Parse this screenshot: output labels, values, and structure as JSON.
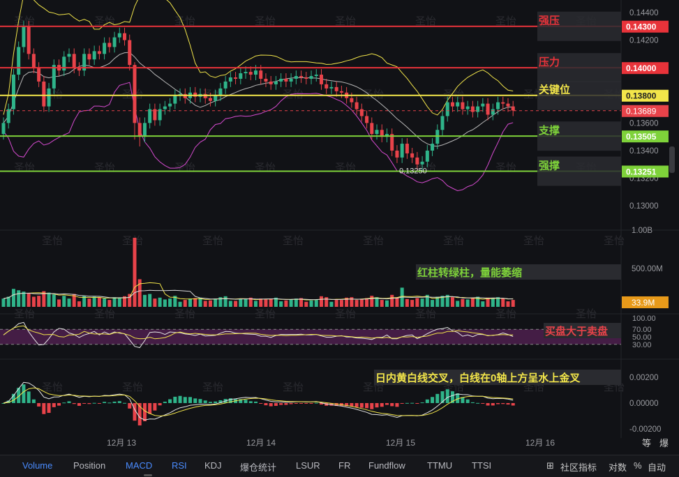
{
  "chart_data": {
    "type": "candlestick",
    "time_labels": [
      "12月 13",
      "12月 14",
      "12月 15",
      "12月 16"
    ],
    "price_axis": {
      "range": [
        0.129,
        0.1445
      ],
      "ticks": [
        "0.14400",
        "0.14200",
        "0.14000",
        "0.13800",
        "0.13600",
        "0.13400",
        "0.13200",
        "0.13000"
      ],
      "tick_values": [
        0.144,
        0.142,
        0.14,
        0.138,
        0.136,
        0.134,
        0.132,
        0.13
      ]
    },
    "levels": [
      {
        "label": "强压",
        "price": 0.143,
        "price_label": "0.14300",
        "color": "#e8333a"
      },
      {
        "label": "压力",
        "price": 0.14,
        "price_label": "0.14000",
        "color": "#e8333a"
      },
      {
        "label": "关键位",
        "price": 0.138,
        "price_label": "0.13800",
        "color": "#f3e64a"
      },
      {
        "label": "支撑",
        "price": 0.13505,
        "price_label": "0.13505",
        "color": "#7ed23a"
      },
      {
        "label": "强撑",
        "price": 0.13251,
        "price_label": "0.13251",
        "color": "#7ed23a"
      }
    ],
    "current_price": {
      "value": 0.13689,
      "label": "0.13689"
    },
    "low_marker": {
      "value": 0.1325,
      "label": "0.13250"
    },
    "closes": [
      0.136,
      0.137,
      0.1395,
      0.1415,
      0.143,
      0.141,
      0.14,
      0.139,
      0.1372,
      0.1385,
      0.1402,
      0.1398,
      0.1408,
      0.141,
      0.14,
      0.1398,
      0.141,
      0.1406,
      0.1412,
      0.141,
      0.1418,
      0.1415,
      0.1422,
      0.1425,
      0.142,
      0.1402,
      0.136,
      0.135,
      0.136,
      0.137,
      0.1362,
      0.137,
      0.1372,
      0.1374,
      0.138,
      0.1381,
      0.1378,
      0.1382,
      0.1379,
      0.1381,
      0.1378,
      0.1376,
      0.138,
      0.1385,
      0.139,
      0.1393,
      0.1392,
      0.1396,
      0.1397,
      0.1395,
      0.1398,
      0.1392,
      0.139,
      0.1388,
      0.139,
      0.1392,
      0.139,
      0.1392,
      0.1394,
      0.1393,
      0.1392,
      0.1394,
      0.1395,
      0.1388,
      0.1385,
      0.1386,
      0.1383,
      0.1382,
      0.1378,
      0.1375,
      0.137,
      0.1365,
      0.136,
      0.1352,
      0.1355,
      0.135,
      0.1352,
      0.134,
      0.1335,
      0.1345,
      0.1338,
      0.1335,
      0.133,
      0.1332,
      0.134,
      0.1345,
      0.1355,
      0.1365,
      0.1375,
      0.1372,
      0.1375,
      0.137,
      0.1372,
      0.1368,
      0.1372,
      0.1374,
      0.1366,
      0.137,
      0.1375,
      0.1374,
      0.1372,
      0.1369
    ],
    "volume_axis": {
      "ticks": [
        "1.00B",
        "500.00M"
      ],
      "tick_values": [
        1000,
        500
      ],
      "max": 1000
    },
    "current_volume": {
      "label": "33.9M",
      "value": 33.9
    },
    "volume_annotation": "红柱转绿柱，量能萎缩",
    "rsi_axis": {
      "ticks": [
        "100.00",
        "70.00",
        "50.00",
        "30.00"
      ],
      "tick_values": [
        100,
        70,
        50,
        30
      ]
    },
    "rsi_annotation": "买盘大于卖盘",
    "macd_axis": {
      "ticks": [
        "0.00200",
        "0.00000",
        "-0.00200"
      ],
      "tick_values": [
        0.002,
        0,
        -0.002
      ]
    },
    "macd_annotation": "日内黄白线交叉，白线在0轴上方呈水上金叉",
    "colors": {
      "up": "#2fb48a",
      "down": "#e8434a",
      "yellow": "#f3e64a",
      "white": "#d9d9d9",
      "magenta": "#d64bd0"
    }
  },
  "watermark": "圣怡",
  "toolbar": {
    "tabs": [
      "Volume",
      "Position",
      "MACD",
      "RSI",
      "KDJ",
      "爆仓统计",
      "LSUR",
      "FR",
      "Fundflow",
      "TTMU",
      "TTSI"
    ],
    "active_tabs": [
      "Volume",
      "MACD",
      "RSI"
    ],
    "community_icon": "grid-add-icon",
    "community_label": "社区指标",
    "scale_log": "对数",
    "scale_pct": "%",
    "scale_auto": "自动"
  },
  "axis_buttons": {
    "a": "等",
    "b": "爆"
  }
}
